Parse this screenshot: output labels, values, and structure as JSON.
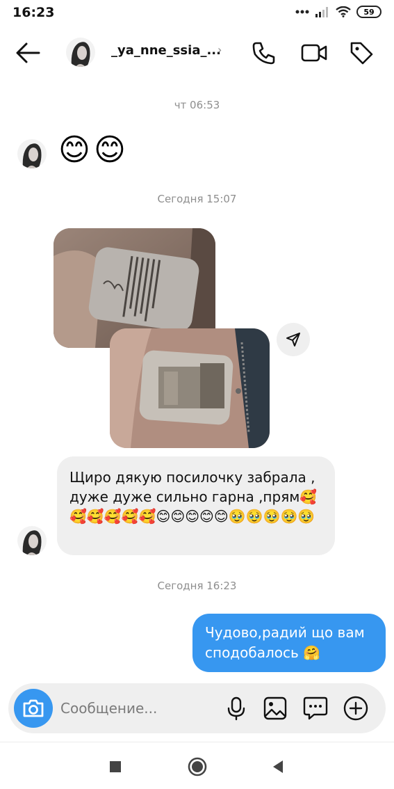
{
  "status_bar": {
    "time": "16:23",
    "battery": "59",
    "icons": [
      "dots-icon",
      "signal-icon",
      "wifi-icon",
      "battery-icon"
    ]
  },
  "header": {
    "username": "_ya_nne_ssia_...",
    "chevron": "›",
    "icons": [
      "back-arrow-icon",
      "phone-icon",
      "video-camera-icon",
      "tag-icon"
    ]
  },
  "messages": {
    "timestamp_1": "чт 06:53",
    "emoji_1": "😊",
    "emoji_2": "😊",
    "timestamp_2": "Сегодня 15:07",
    "incoming_text": "Щиро дякую посилочку забрала , дуже дуже сильно гарна ,прям🥰🥰🥰🥰🥰🥰😊😊😊😊😊🥹🥹🥹🥹🥹",
    "timestamp_3": "Сегодня 16:23",
    "outgoing_text": "Чудово,радий що вам сподобалось 🤗"
  },
  "composer": {
    "placeholder": "Сообщение...",
    "icons": [
      "camera-icon",
      "microphone-icon",
      "gallery-icon",
      "sticker-icon",
      "plus-icon"
    ]
  },
  "colors": {
    "accent": "#3797f0",
    "bubble_incoming": "#efefef",
    "timestamp": "#8e8e8e"
  }
}
